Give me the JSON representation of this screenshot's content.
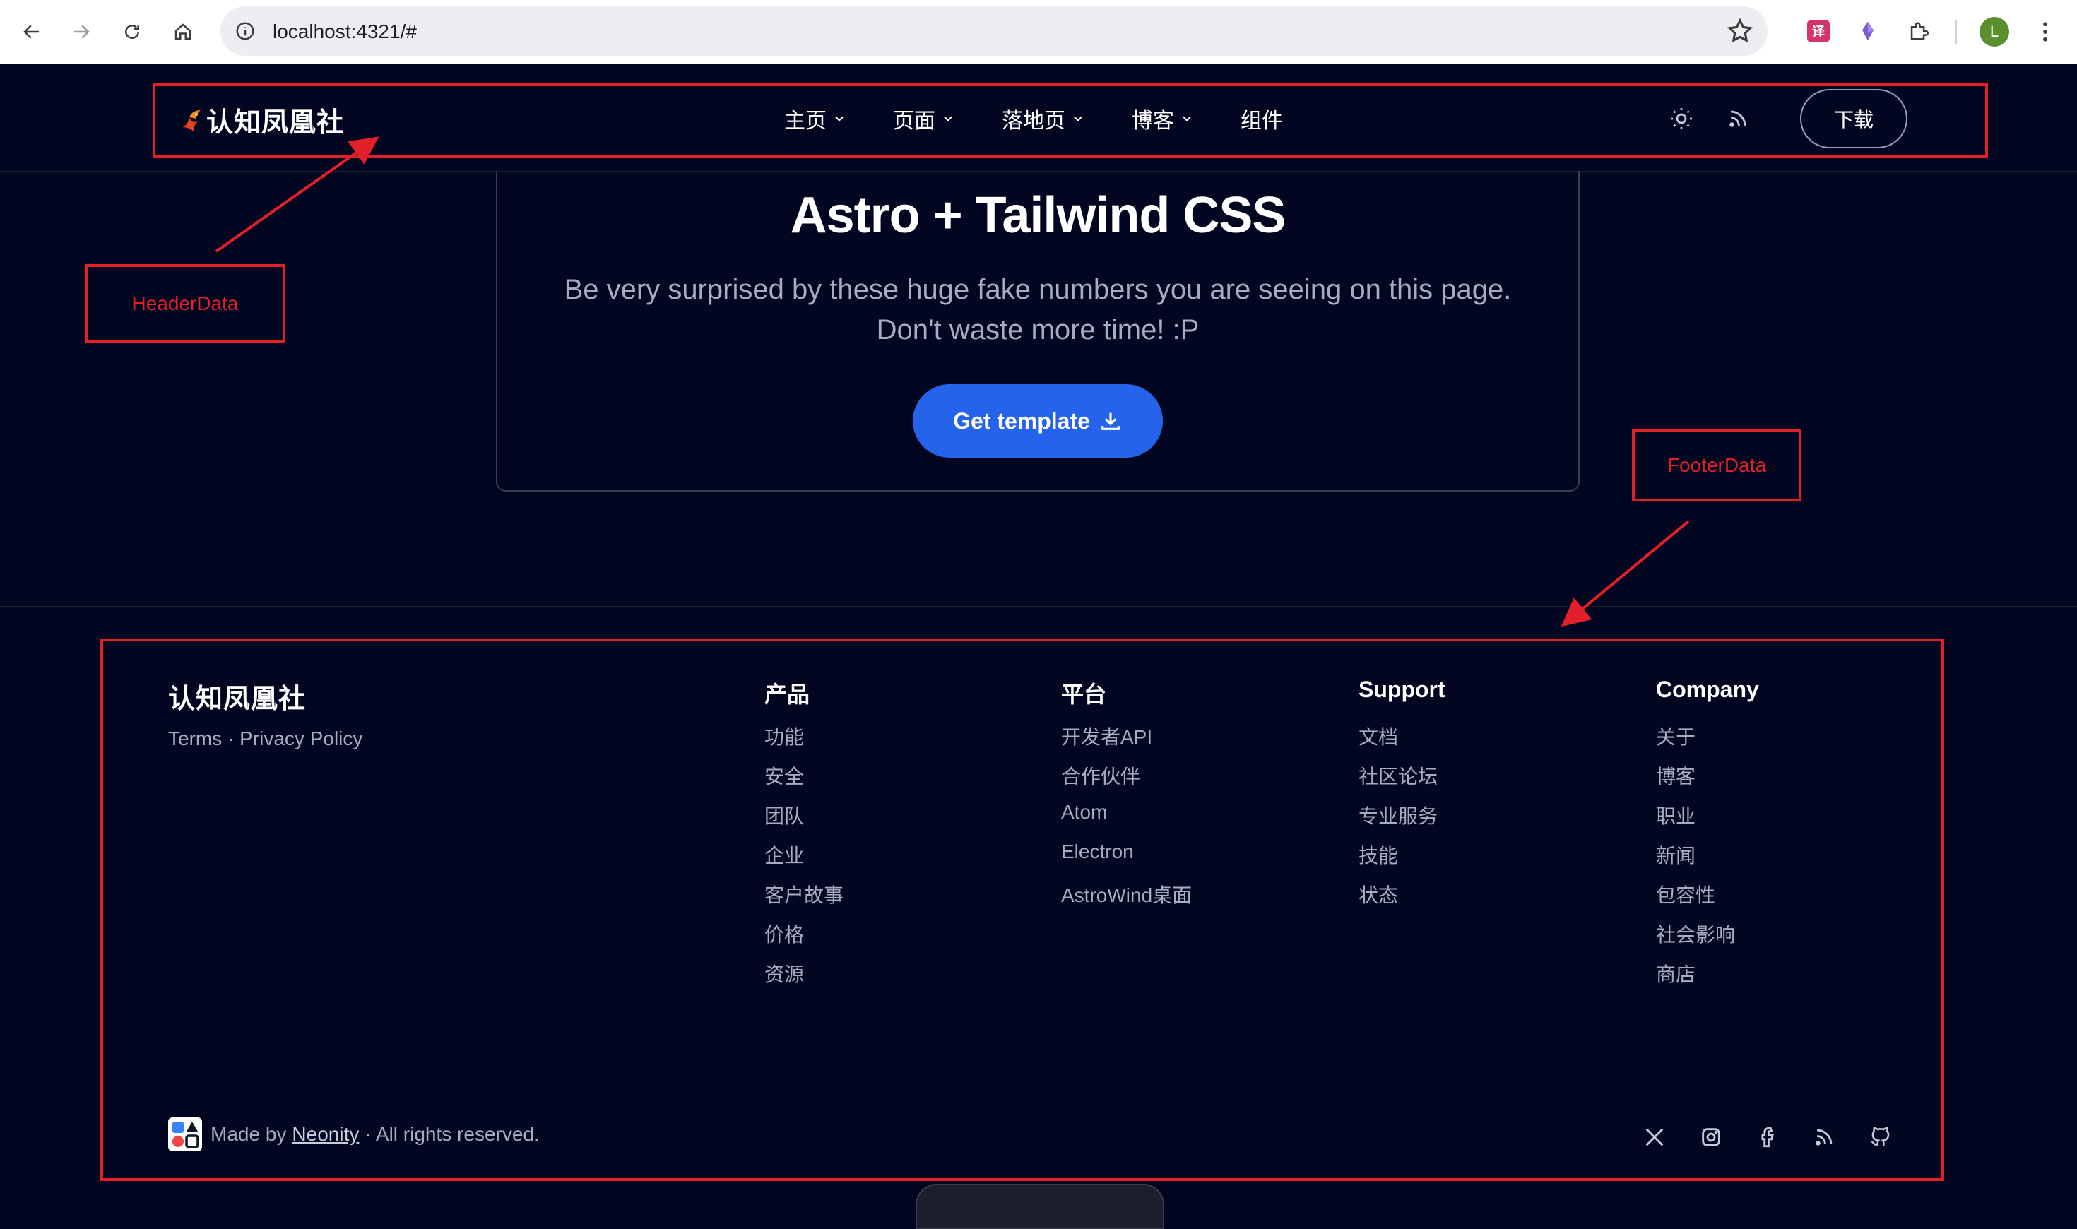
{
  "browser": {
    "url": "localhost:4321/#",
    "avatar_letter": "L",
    "translate_ext": "译"
  },
  "header": {
    "logo_text": "认知凤凰社",
    "nav": [
      {
        "label": "主页",
        "dropdown": true
      },
      {
        "label": "页面",
        "dropdown": true
      },
      {
        "label": "落地页",
        "dropdown": true
      },
      {
        "label": "博客",
        "dropdown": true
      },
      {
        "label": "组件",
        "dropdown": false
      }
    ],
    "download_label": "下载"
  },
  "cta": {
    "title": "Astro + Tailwind CSS",
    "subtitle_line1": "Be very surprised by these huge fake numbers you are seeing on this page.",
    "subtitle_line2": "Don't waste more time! :P",
    "button_label": "Get template"
  },
  "footer": {
    "brand": "认知凤凰社",
    "terms": "Terms",
    "separator": "·",
    "privacy": "Privacy Policy",
    "columns": [
      {
        "title": "产品",
        "links": [
          "功能",
          "安全",
          "团队",
          "企业",
          "客户故事",
          "价格",
          "资源"
        ]
      },
      {
        "title": "平台",
        "links": [
          "开发者API",
          "合作伙伴",
          "Atom",
          "Electron",
          "AstroWind桌面"
        ]
      },
      {
        "title": "Support",
        "links": [
          "文档",
          "社区论坛",
          "专业服务",
          "技能",
          "状态"
        ]
      },
      {
        "title": "Company",
        "links": [
          "关于",
          "博客",
          "职业",
          "新闻",
          "包容性",
          "社会影响",
          "商店"
        ]
      }
    ],
    "made_by_prefix": "Made by",
    "made_by_link": "Neonity",
    "made_by_suffix": "· All rights reserved.",
    "social_icons": [
      "x-icon",
      "instagram-icon",
      "facebook-icon",
      "rss-icon",
      "github-icon"
    ]
  },
  "annotations": {
    "header_label": "HeaderData",
    "footer_label": "FooterData",
    "color": "#e3202a"
  },
  "colors": {
    "background": "#030620",
    "accent": "#2563eb",
    "muted_text": "#a3aec2"
  }
}
